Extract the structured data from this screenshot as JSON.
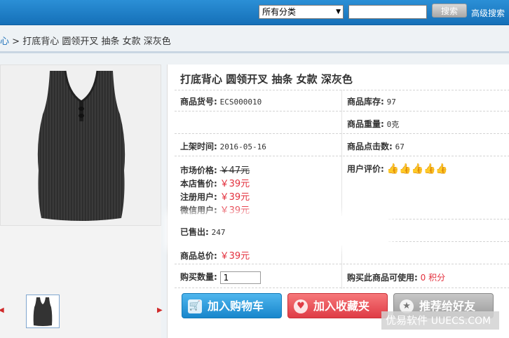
{
  "header": {
    "category": "所有分类",
    "search_button": "搜索",
    "advanced_search": "高级搜索"
  },
  "breadcrumb": {
    "first": "心",
    "separator": ">",
    "current": "打底背心 圆领开叉 抽条 女款 深灰色"
  },
  "product": {
    "title": "打底背心 圆领开叉 抽条 女款 深灰色",
    "sku_label": "商品货号:",
    "sku": "ECS000010",
    "stock_label": "商品库存:",
    "stock": "97",
    "weight_label": "商品重量:",
    "weight": "0克",
    "date_label": "上架时间:",
    "date": "2016-05-16",
    "clicks_label": "商品点击数:",
    "clicks": "67",
    "market_price_label": "市场价格:",
    "market_price": "￥47元",
    "shop_price_label": "本店售价:",
    "shop_price": "￥39元",
    "reg_price_label": "注册用户:",
    "reg_price": "￥39元",
    "wechat_price_label": "微信用户:",
    "wechat_price": "￥39元",
    "rating_label": "用户评价:",
    "rating": 5,
    "sold_label": "已售出:",
    "sold": "247",
    "total_label": "商品总价:",
    "total": "￥39元",
    "qty_label": "购买数量:",
    "qty": "1",
    "points_label": "购买此商品可使用:",
    "points": "0 积分"
  },
  "buttons": {
    "cart": "加入购物车",
    "favorite": "加入收藏夹",
    "recommend": "推荐给好友"
  },
  "watermark": {
    "brand": "优易软件",
    "domain": "UUECS.COM"
  }
}
